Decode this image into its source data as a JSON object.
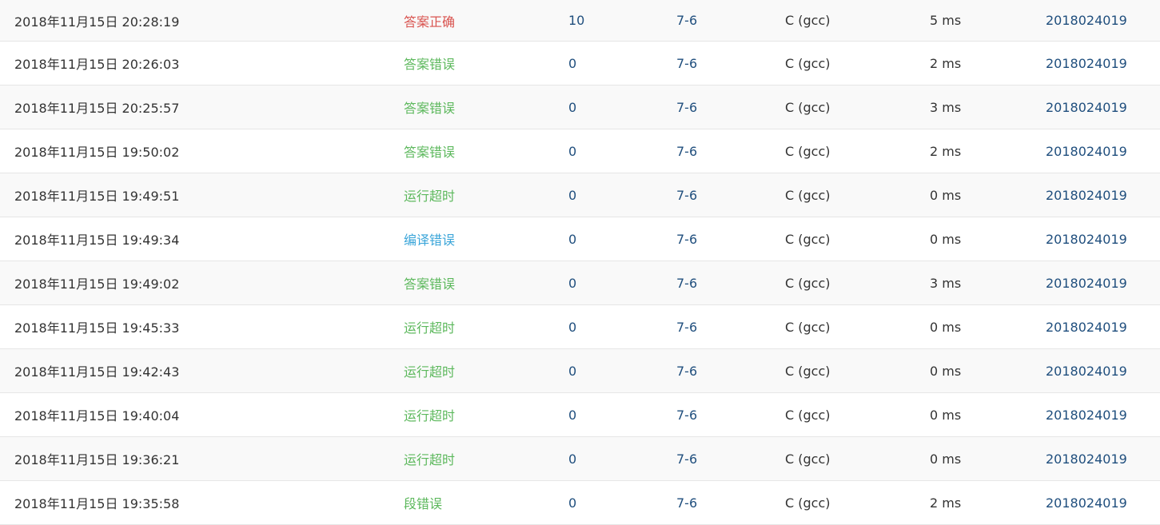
{
  "colors": {
    "accepted": "#d9534f",
    "wrong": "#5cb85c",
    "compile_error": "#3aa5d9",
    "link": "#1f4e7d"
  },
  "rows": [
    {
      "time": "2018年11月15日 20:28:19",
      "status": "答案正确",
      "status_type": "accepted",
      "score": "10",
      "problem": "7-6",
      "compiler": "C (gcc)",
      "time_cost": "5 ms",
      "user": "2018024019"
    },
    {
      "time": "2018年11月15日 20:26:03",
      "status": "答案错误",
      "status_type": "wrong",
      "score": "0",
      "problem": "7-6",
      "compiler": "C (gcc)",
      "time_cost": "2 ms",
      "user": "2018024019"
    },
    {
      "time": "2018年11月15日 20:25:57",
      "status": "答案错误",
      "status_type": "wrong",
      "score": "0",
      "problem": "7-6",
      "compiler": "C (gcc)",
      "time_cost": "3 ms",
      "user": "2018024019"
    },
    {
      "time": "2018年11月15日 19:50:02",
      "status": "答案错误",
      "status_type": "wrong",
      "score": "0",
      "problem": "7-6",
      "compiler": "C (gcc)",
      "time_cost": "2 ms",
      "user": "2018024019"
    },
    {
      "time": "2018年11月15日 19:49:51",
      "status": "运行超时",
      "status_type": "timeout",
      "score": "0",
      "problem": "7-6",
      "compiler": "C (gcc)",
      "time_cost": "0 ms",
      "user": "2018024019"
    },
    {
      "time": "2018年11月15日 19:49:34",
      "status": "编译错误",
      "status_type": "compile",
      "score": "0",
      "problem": "7-6",
      "compiler": "C (gcc)",
      "time_cost": "0 ms",
      "user": "2018024019"
    },
    {
      "time": "2018年11月15日 19:49:02",
      "status": "答案错误",
      "status_type": "wrong",
      "score": "0",
      "problem": "7-6",
      "compiler": "C (gcc)",
      "time_cost": "3 ms",
      "user": "2018024019"
    },
    {
      "time": "2018年11月15日 19:45:33",
      "status": "运行超时",
      "status_type": "timeout",
      "score": "0",
      "problem": "7-6",
      "compiler": "C (gcc)",
      "time_cost": "0 ms",
      "user": "2018024019"
    },
    {
      "time": "2018年11月15日 19:42:43",
      "status": "运行超时",
      "status_type": "timeout",
      "score": "0",
      "problem": "7-6",
      "compiler": "C (gcc)",
      "time_cost": "0 ms",
      "user": "2018024019"
    },
    {
      "time": "2018年11月15日 19:40:04",
      "status": "运行超时",
      "status_type": "timeout",
      "score": "0",
      "problem": "7-6",
      "compiler": "C (gcc)",
      "time_cost": "0 ms",
      "user": "2018024019"
    },
    {
      "time": "2018年11月15日 19:36:21",
      "status": "运行超时",
      "status_type": "timeout",
      "score": "0",
      "problem": "7-6",
      "compiler": "C (gcc)",
      "time_cost": "0 ms",
      "user": "2018024019"
    },
    {
      "time": "2018年11月15日 19:35:58",
      "status": "段错误",
      "status_type": "segfault",
      "score": "0",
      "problem": "7-6",
      "compiler": "C (gcc)",
      "time_cost": "2 ms",
      "user": "2018024019"
    }
  ]
}
